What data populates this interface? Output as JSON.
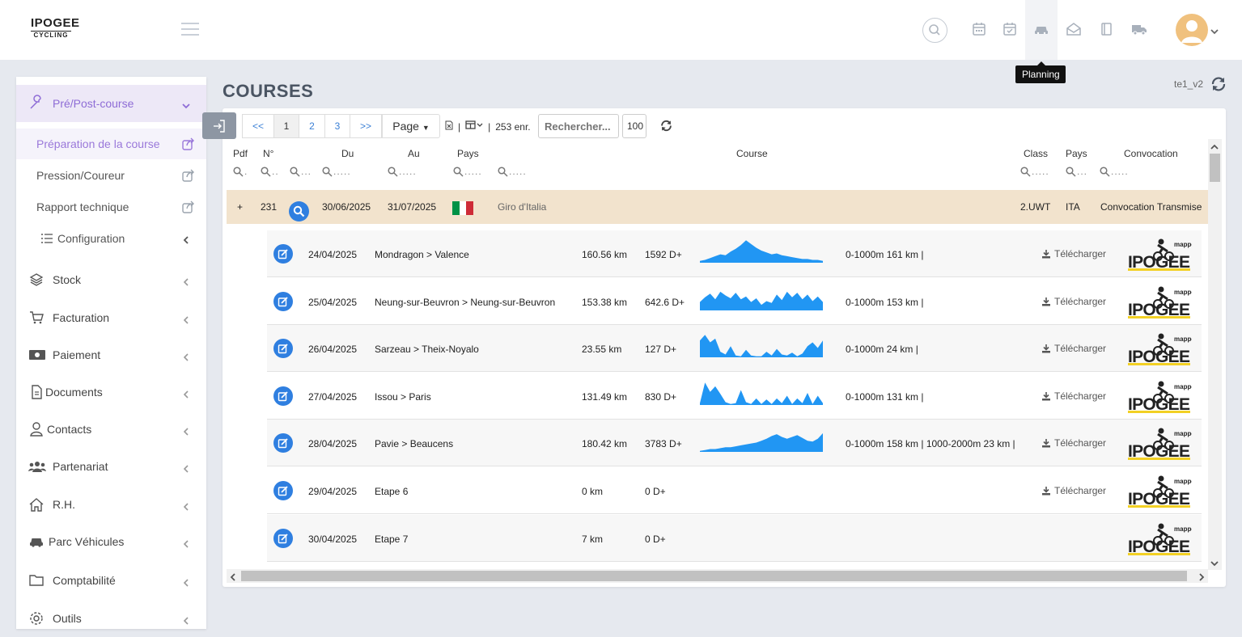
{
  "brand": {
    "line1": "IPOGEE",
    "line2": "CYCLING"
  },
  "header": {
    "icons": [
      "search-icon",
      "calendar-icon",
      "calendar-check-icon",
      "car-icon",
      "envelope-open-icon",
      "book-icon",
      "truck-icon"
    ],
    "tooltip": "Planning"
  },
  "sidebar": {
    "active": {
      "label": "Pré/Post-course"
    },
    "subitems": [
      {
        "label": "Préparation de la course"
      },
      {
        "label": "Pression/Coureur"
      },
      {
        "label": "Rapport technique"
      },
      {
        "label": "Configuration"
      }
    ],
    "items": [
      {
        "label": "Stock"
      },
      {
        "label": "Facturation"
      },
      {
        "label": "Paiement"
      },
      {
        "label": "Documents"
      },
      {
        "label": "Contacts"
      },
      {
        "label": "Partenariat"
      },
      {
        "label": "R.H."
      },
      {
        "label": "Parc Véhicules"
      },
      {
        "label": "Comptabilité"
      },
      {
        "label": "Outils"
      }
    ]
  },
  "page": {
    "title": "COURSES",
    "version": "te1_v2"
  },
  "toolbar": {
    "prev": "<<",
    "pages": [
      "1",
      "2",
      "3"
    ],
    "next": ">>",
    "page_select": "Page",
    "separator": "|",
    "count": "253 enr.",
    "search_placeholder": "Rechercher...",
    "page_size": "100"
  },
  "columns": {
    "pdf": "Pdf",
    "num": "N°",
    "du": "Du",
    "au": "Au",
    "pays": "Pays",
    "course": "Course",
    "class": "Class",
    "pays2": "Pays",
    "convocation": "Convocation"
  },
  "filter_placeholder": ".....",
  "filter_short": "...",
  "race": {
    "plus": "+",
    "num": "231",
    "du": "30/06/2025",
    "au": "31/07/2025",
    "flag_colors": [
      "#009246",
      "#ffffff",
      "#ce2b37"
    ],
    "name": "Giro d'Italia",
    "class": "2.UWT",
    "country": "ITA",
    "convocation": "Convocation Transmise"
  },
  "stages": [
    {
      "date": "24/04/2025",
      "route": "Mondragon > Valence",
      "distance": "160.56 km",
      "elevation": "1592 D+",
      "tranches": "0-1000m 161 km |",
      "download": "Télécharger",
      "profile": [
        2,
        3,
        5,
        7,
        9,
        8,
        12,
        15,
        19,
        24,
        20,
        16,
        13,
        11,
        9,
        10,
        8,
        7,
        6,
        5,
        4,
        4,
        3,
        3,
        2
      ]
    },
    {
      "date": "25/04/2025",
      "route": "Neung-sur-Beuvron > Neung-sur-Beuvron",
      "distance": "153.38 km",
      "elevation": "642.6 D+",
      "tranches": "0-1000m 153 km |",
      "download": "Télécharger",
      "profile": [
        9,
        14,
        18,
        12,
        20,
        16,
        13,
        19,
        12,
        15,
        9,
        13,
        6,
        10,
        8,
        17,
        11,
        20,
        14,
        19,
        12,
        17,
        10,
        15,
        9
      ]
    },
    {
      "date": "26/04/2025",
      "route": "Sarzeau > Theix-Noyalo",
      "distance": "23.55 km",
      "elevation": "127 D+",
      "tranches": "0-1000m 24 km |",
      "download": "Télécharger",
      "profile": [
        18,
        24,
        16,
        20,
        6,
        3,
        12,
        2,
        1,
        8,
        2,
        1,
        1,
        6,
        2,
        9,
        3,
        2,
        5,
        1,
        4,
        12,
        16,
        10,
        18
      ]
    },
    {
      "date": "27/04/2025",
      "route": "Issou > Paris",
      "distance": "131.49 km",
      "elevation": "830 D+",
      "tranches": "0-1000m 131 km |",
      "download": "Télécharger",
      "profile": [
        2,
        24,
        14,
        20,
        12,
        3,
        1,
        2,
        16,
        3,
        1,
        7,
        1,
        6,
        1,
        7,
        2,
        10,
        1,
        7,
        2,
        13,
        1,
        10,
        2
      ]
    },
    {
      "date": "28/04/2025",
      "route": "Pavie > Beaucens",
      "distance": "180.42 km",
      "elevation": "3783 D+",
      "tranches": "0-1000m 158 km | 1000-2000m 23 km |",
      "download": "Télécharger",
      "profile": [
        1,
        2,
        3,
        3,
        4,
        5,
        5,
        6,
        7,
        8,
        9,
        10,
        12,
        14,
        17,
        19,
        16,
        14,
        16,
        18,
        15,
        12,
        11,
        14,
        20
      ]
    },
    {
      "date": "29/04/2025",
      "route": "Etape 6",
      "distance": "0 km",
      "elevation": "0 D+",
      "tranches": "",
      "download": "Télécharger",
      "profile": []
    },
    {
      "date": "30/04/2025",
      "route": "Etape 7",
      "distance": "7 km",
      "elevation": "0 D+",
      "tranches": "",
      "download": "",
      "profile": []
    }
  ],
  "stage_logo": {
    "word": "IPOGEE",
    "tag": "mapper"
  },
  "colors": {
    "accent": "#8e6cd6",
    "primary": "#2f7fe0",
    "race_row": "#f2e3cd",
    "profile": "#2196f3"
  }
}
